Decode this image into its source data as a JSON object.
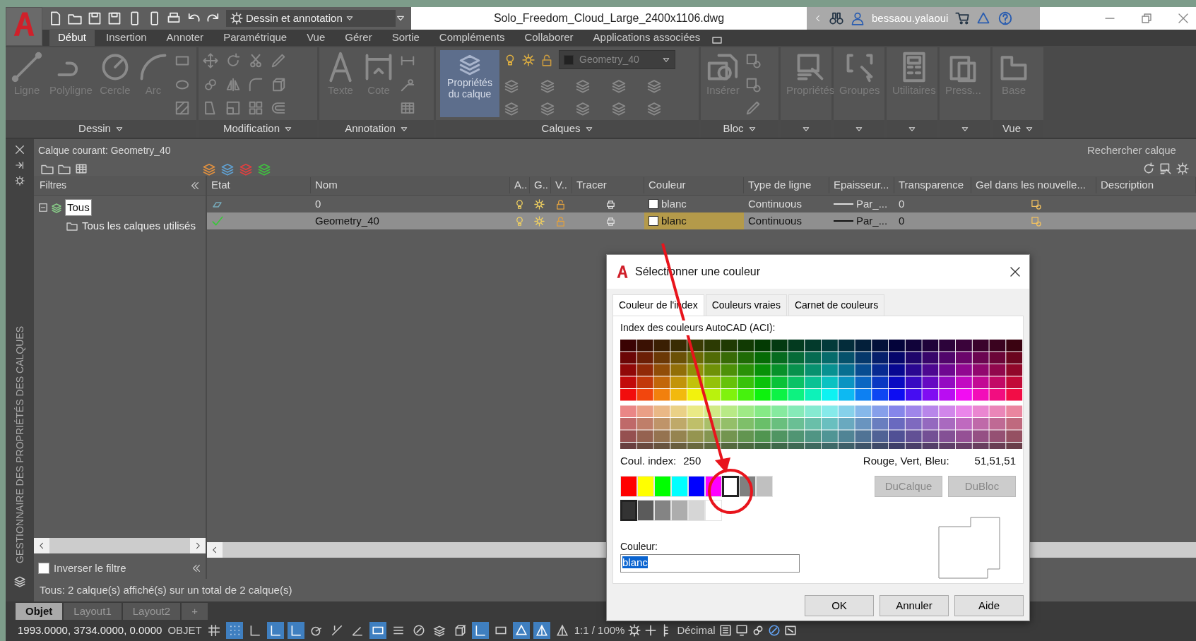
{
  "title_bar": {
    "workspace": "Dessin et annotation",
    "file_title": "Solo_Freedom_Cloud_Large_2400x1106.dwg",
    "user": "bessaou.yalaoui"
  },
  "ribbon_tabs": [
    {
      "label": "Début",
      "selected": true
    },
    {
      "label": "Insertion",
      "selected": false
    },
    {
      "label": "Annoter",
      "selected": false
    },
    {
      "label": "Paramétrique",
      "selected": false
    },
    {
      "label": "Vue",
      "selected": false
    },
    {
      "label": "Gérer",
      "selected": false
    },
    {
      "label": "Sortie",
      "selected": false
    },
    {
      "label": "Compléments",
      "selected": false
    },
    {
      "label": "Collaborer",
      "selected": false
    },
    {
      "label": "Applications associées",
      "selected": false
    }
  ],
  "ribbon_panels": [
    {
      "title": "Dessin",
      "kind": "draw",
      "tools": [
        {
          "label": "Ligne"
        },
        {
          "label": "Polyligne"
        },
        {
          "label": "Cercle"
        },
        {
          "label": "Arc"
        }
      ]
    },
    {
      "title": "Modification",
      "kind": "modify"
    },
    {
      "title": "Annotation",
      "kind": "annotate",
      "tools": [
        {
          "label": "Texte"
        },
        {
          "label": "Cote"
        }
      ]
    },
    {
      "title": "Calques",
      "kind": "layers",
      "tools": [
        {
          "label": "Propriétés du calque"
        }
      ],
      "layer_dropdown": "Geometry_40"
    },
    {
      "title": "Bloc",
      "kind": "block",
      "tools": [
        {
          "label": "Insérer"
        }
      ]
    },
    {
      "kind": "properties",
      "tools": [
        {
          "label": "Propriétés"
        }
      ]
    },
    {
      "kind": "groups",
      "tools": [
        {
          "label": "Groupes"
        }
      ]
    },
    {
      "kind": "utilities",
      "tools": [
        {
          "label": "Utilitaires"
        }
      ]
    },
    {
      "kind": "clipboard",
      "tools": [
        {
          "label": "Press..."
        }
      ]
    },
    {
      "title": "Vue",
      "kind": "view",
      "tools": [
        {
          "label": "Base"
        }
      ]
    }
  ],
  "layer_manager": {
    "side_title": "GESTIONNAIRE DES PROPRIÉTÉS DES CALQUES",
    "current_layer": "Calque courant: Geometry_40",
    "search_placeholder": "Rechercher calque",
    "filters_title": "Filtres",
    "filter_tree": [
      {
        "label": "Tous",
        "selected": true,
        "expanded": true,
        "children": [
          {
            "label": "Tous les calques utilisés",
            "selected": false
          }
        ]
      }
    ],
    "invert_filter": {
      "label": "Inverser le filtre",
      "checked": false
    },
    "columns": [
      "Etat",
      "Nom",
      "A..",
      "G..",
      "V..",
      "Tracer",
      "Couleur",
      "Type de ligne",
      "Epaisseur...",
      "Transparence",
      "Gel dans les nouvelle...",
      "Description"
    ],
    "rows": [
      {
        "current": false,
        "selected": false,
        "name": "0",
        "on": true,
        "frozen": false,
        "locked": false,
        "color_name": "blanc",
        "color_focused": false,
        "linetype": "Continuous",
        "lineweight": "Par_...",
        "transparency": "0"
      },
      {
        "current": true,
        "selected": true,
        "name": "Geometry_40",
        "on": true,
        "frozen": false,
        "locked": false,
        "color_name": "blanc",
        "color_focused": true,
        "linetype": "Continuous",
        "lineweight": "Par_...",
        "transparency": "0"
      }
    ],
    "status": "Tous: 2 calque(s) affiché(s) sur un total de 2 calque(s)"
  },
  "color_dialog": {
    "title": "Sélectionner une couleur",
    "tabs": [
      {
        "label": "Couleur de l'index",
        "selected": true
      },
      {
        "label": "Couleurs vraies",
        "selected": false
      },
      {
        "label": "Carnet de couleurs",
        "selected": false
      }
    ],
    "aci_label": "Index des couleurs AutoCAD (ACI):",
    "index_label": "Coul. index:",
    "index_value": "250",
    "rgb_label": "Rouge, Vert, Bleu:",
    "rgb_value": "51,51,51",
    "standard_colors": [
      {
        "color": "#ff0000",
        "selected": false
      },
      {
        "color": "#ffff00",
        "selected": false
      },
      {
        "color": "#00ff00",
        "selected": false
      },
      {
        "color": "#00ffff",
        "selected": false
      },
      {
        "color": "#0000ff",
        "selected": false
      },
      {
        "color": "#ff00ff",
        "selected": false
      },
      {
        "color": "#ffffff",
        "selected": true
      },
      {
        "color": "#808080",
        "selected": false
      },
      {
        "color": "#c0c0c0",
        "selected": false
      }
    ],
    "gray_colors": [
      {
        "color": "#333333",
        "selected": true
      },
      {
        "color": "#5b5b5b",
        "selected": false
      },
      {
        "color": "#848484",
        "selected": false
      },
      {
        "color": "#adadad",
        "selected": false
      },
      {
        "color": "#d6d6d6",
        "selected": false
      },
      {
        "color": "#ffffff",
        "selected": false
      }
    ],
    "side_buttons": [
      {
        "label": "DuCalque",
        "disabled": true
      },
      {
        "label": "DuBloc",
        "disabled": true
      }
    ],
    "field_label": "Couleur:",
    "field_value": "blanc",
    "buttons": [
      "OK",
      "Annuler",
      "Aide"
    ]
  },
  "layout_tabs": [
    {
      "label": "Objet",
      "selected": true
    },
    {
      "label": "Layout1",
      "selected": false
    },
    {
      "label": "Layout2",
      "selected": false
    }
  ],
  "add_tab": "+",
  "status_bar": {
    "coordinates": "1993.0000, 3734.0000, 0.0000",
    "space": "OBJET",
    "scale": "1:1 / 100%",
    "units": "Décimal",
    "toggles": [
      {
        "kind": "grid",
        "on": false
      },
      {
        "kind": "snap",
        "on": true
      },
      {
        "kind": "infer",
        "on": false
      },
      {
        "kind": "ortho",
        "on": true
      },
      {
        "kind": "polar",
        "on": true
      },
      {
        "kind": "iso",
        "on": false
      },
      {
        "kind": "track",
        "on": false
      },
      {
        "kind": "angle",
        "on": false
      },
      {
        "kind": "osnap",
        "on": true
      },
      {
        "kind": "lineweight",
        "on": false
      },
      {
        "kind": "transparency",
        "on": false
      },
      {
        "kind": "cycle",
        "on": false
      },
      {
        "kind": "box",
        "on": false
      },
      {
        "kind": "ucs",
        "on": true
      },
      {
        "kind": "filter",
        "on": false
      },
      {
        "kind": "gizmo",
        "on": true
      },
      {
        "kind": "annovis",
        "on": true
      },
      {
        "kind": "autoscale",
        "on": false
      }
    ]
  }
}
